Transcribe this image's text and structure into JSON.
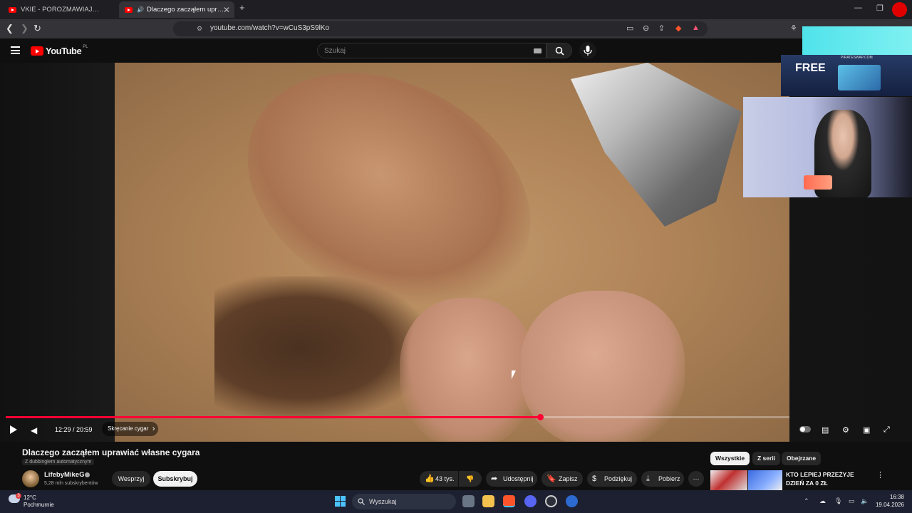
{
  "browser": {
    "tabs": [
      {
        "title": "VKIE - POROZMAWIAJMY O PLANACH"
      },
      {
        "title": "Dlaczego zacząłem uprawiać"
      }
    ],
    "url": "youtube.com/watch?v=wCuS3pS9lKo"
  },
  "youtube": {
    "logo_text": "YouTube",
    "logo_country": "PL",
    "search_placeholder": "Szukaj"
  },
  "ad": {
    "domain": "PIRATESWAP.COM",
    "headline": "FREE"
  },
  "player": {
    "progress_fraction": 0.682,
    "current_time": "12:29",
    "duration": "20:59",
    "time_text": "12:29 / 20:59",
    "chapter": "Skręcanie cygar"
  },
  "video": {
    "title": "Dlaczego zacząłem uprawiać własne cygara",
    "dub_note": "Z dubbingiem automatycznym",
    "channel_name": "LifebyMikeG",
    "subscribers": "5,28 mln subskrybentów",
    "support_label": "Wesprzyj",
    "subscribe_label": "Subskrybuj",
    "likes": "43 tys.",
    "share_label": "Udostępnij",
    "save_label": "Zapisz",
    "thanks_label": "Podziękuj",
    "download_label": "Pobierz"
  },
  "sidebar": {
    "chips": [
      "Wszystkie",
      "Z serii",
      "Obejrzane"
    ],
    "recommendation_title": "KTO LEPIEJ PRZEŻYJE DZIEŃ ZA 0 ZŁ"
  },
  "taskbar": {
    "weather_badge": "3",
    "temperature": "12°C",
    "condition": "Pochmurnie",
    "search_placeholder": "Wyszukaj",
    "time": "16:38",
    "date": "19.04.2026",
    "colors": {
      "accent": "#4cc2ff",
      "youtube_red": "#ff0033"
    }
  }
}
